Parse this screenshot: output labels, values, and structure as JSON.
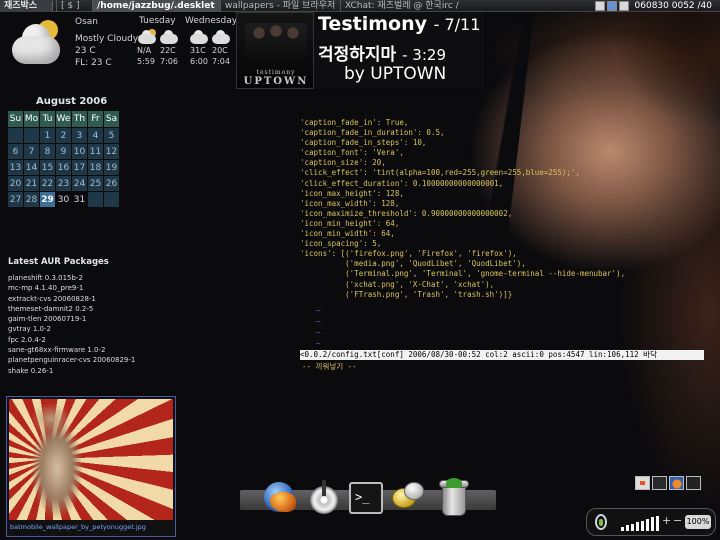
{
  "top_panel": {
    "menu_label": "재즈박스",
    "tasks": [
      "[ $ ]",
      "/home/jazzbug/.desklet",
      "wallpapers - 파일 브라우저",
      "XChat: 재즈벌레 @ 한국irc / #ubuntu",
      ""
    ],
    "clock": "060830 0052 /40"
  },
  "weather": {
    "city": "Osan",
    "condition": "Mostly Cloudy",
    "temp": "23 C",
    "feels_like": "FL: 23 C",
    "days": [
      {
        "name": "Tuesday",
        "hi": "N/A",
        "lo": "22C",
        "sunrise": "5:59",
        "sunset": "7:06"
      },
      {
        "name": "Wednesday",
        "hi": "31C",
        "lo": "20C",
        "sunrise": "6:00",
        "sunset": "7:04"
      }
    ]
  },
  "now_playing": {
    "album_small": "testimony",
    "album_band": "UPTOWN",
    "title": "Testimony",
    "track": "- 7/11",
    "song": "걱정하지마",
    "time": "- 3:29",
    "artist": "by UPTOWN"
  },
  "calendar": {
    "month": "August 2006",
    "weekdays": [
      "Su",
      "Mo",
      "Tu",
      "We",
      "Th",
      "Fr",
      "Sa"
    ],
    "rows": [
      [
        "",
        "",
        "1",
        "2",
        "3",
        "4",
        "5"
      ],
      [
        "6",
        "7",
        "8",
        "9",
        "10",
        "11",
        "12"
      ],
      [
        "13",
        "14",
        "15",
        "16",
        "17",
        "18",
        "19"
      ],
      [
        "20",
        "21",
        "22",
        "23",
        "24",
        "25",
        "26"
      ],
      [
        "27",
        "28",
        "29",
        "30",
        "31",
        "",
        ""
      ]
    ],
    "today": "29"
  },
  "aur": {
    "title": "Latest AUR Packages",
    "packages": [
      "planeshift 0.3.015b-2",
      "mc-mp 4.1.40_pre9-1",
      "extrackt-cvs 20060828-1",
      "themeset-damnit2 0.2-5",
      "gaim-tlen 20060719-1",
      "gvtray 1.0-2",
      "fpc 2.0.4-2",
      "sane-gt68xx-firmware 1.0-2",
      "planetpenguinracer-cvs 20060829-1",
      "shake 0.26-1"
    ]
  },
  "wallpaper_preview": {
    "caption": "batmobile_wallpaper_by_petyonugget.jpg"
  },
  "terminal": {
    "lines": [
      "'caption_fade_in': True,",
      "'caption_fade_in_duration': 0.5,",
      "'caption_fade_in_steps': 10,",
      "'caption_font': 'Vera',",
      "'caption_size': 20,",
      "'click_effect': 'tint(alpha=100,red=255,green=255,blue=255);',",
      "'click_effect_duration': 0.10000000000000001,",
      "'icon_max_height': 128,",
      "'icon_max_width': 128,",
      "'icon_maximize_threshold': 0.90000000000000002,",
      "'icon_min_height': 64,",
      "'icon_min_width': 64,",
      "'icon_spacing': 5,",
      "'icons': [('firefox.png', 'Firefox', 'firefox'),",
      "          ('media.png', 'QuodLibet', 'QuodLibet'),",
      "          ('Terminal.png', 'Terminal', 'gnome-terminal --hide-menubar'),",
      "          ('xchat.png', 'X-Chat', 'xchat'),",
      "          ('FTrash.png', 'Trash', 'trash.sh')]}"
    ],
    "tildes": [
      "~",
      "~",
      "~",
      "~"
    ],
    "status": "<0.0.2/config.txt[conf] 2006/08/30-00:52 col:2 ascii:0 pos:4547 lin:106,112 바닥",
    "insert_mode": "-- 끼워넣기 --"
  },
  "dock": {
    "items": [
      "firefox-icon",
      "media-player-icon",
      "terminal-icon",
      "xchat-icon",
      "trash-icon"
    ],
    "terminal_glyph": ">_"
  },
  "volume": {
    "plus": "+",
    "minus": "−",
    "percent": "100%",
    "level": 1.0
  }
}
